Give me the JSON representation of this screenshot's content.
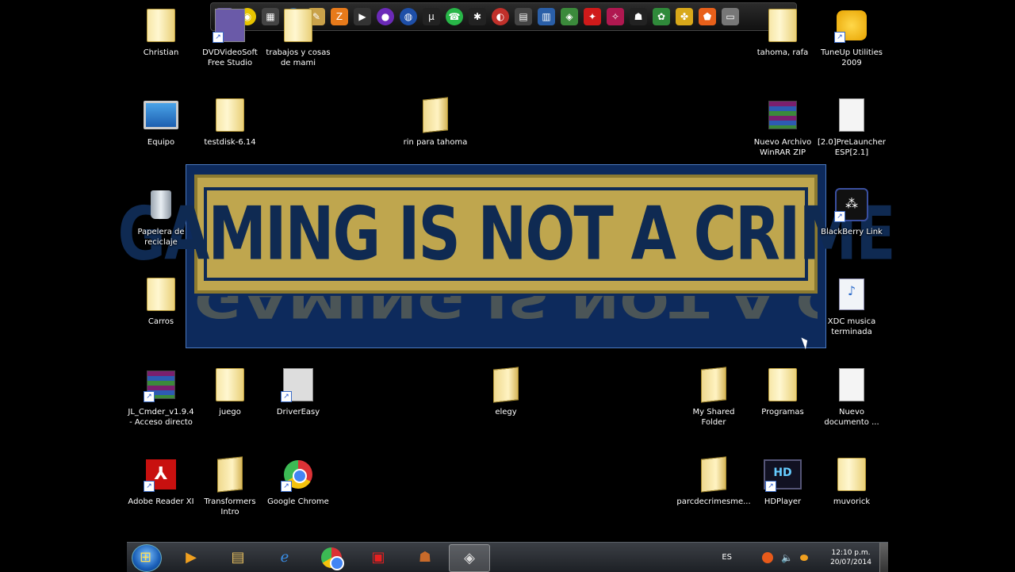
{
  "desktop_icons": [
    {
      "label": "Christian"
    },
    {
      "label": "DVDVideoSoft Free Studio"
    },
    {
      "label": "trabajos y cosas de mami"
    },
    {
      "label": "tahoma, rafa"
    },
    {
      "label": "TuneUp Utilities 2009"
    },
    {
      "label": "Equipo"
    },
    {
      "label": "testdisk-6.14"
    },
    {
      "label": "rin para tahoma"
    },
    {
      "label": "Nuevo Archivo WinRAR ZIP"
    },
    {
      "label": "[2.0]PreLauncher ESP[2.1]"
    },
    {
      "label": "Papelera de reciclaje"
    },
    {
      "label": "BlackBerry Link"
    },
    {
      "label": "Carros"
    },
    {
      "label": "XDC musica terminada"
    },
    {
      "label": "JL_Cmder_v1.9.4 - Acceso directo"
    },
    {
      "label": "juego"
    },
    {
      "label": "DriverEasy"
    },
    {
      "label": "elegy"
    },
    {
      "label": "My Shared Folder"
    },
    {
      "label": "Programas"
    },
    {
      "label": "Nuevo documento ..."
    },
    {
      "label": "Adobe Reader XI"
    },
    {
      "label": "Transformers Intro"
    },
    {
      "label": "Google Chrome"
    },
    {
      "label": "parcdecrimesme..."
    },
    {
      "label": "HDPlayer"
    },
    {
      "label": "muvorick"
    }
  ],
  "banner": {
    "text": "GAMING IS NOT A CRIME"
  },
  "dock_icons": [
    "folder-icon",
    "cd-icon",
    "mw-icon",
    "avast-icon",
    "tool-icon",
    "zone-icon",
    "media-icon",
    "orb-icon",
    "globe-icon",
    "utorrent-icon",
    "line-icon",
    "spider-icon",
    "game-icon",
    "gta-icon",
    "net-icon",
    "nvidia-icon",
    "red-icon",
    "dragon-icon",
    "spy-icon",
    "scan-icon",
    "gear-icon",
    "shield-icon",
    "drive-icon"
  ],
  "taskbar": {
    "apps": [
      "media-player-icon",
      "explorer-icon",
      "internet-explorer-icon",
      "chrome-icon",
      "kmplayer-icon",
      "game-character-icon",
      "game-app-icon"
    ],
    "lang": "ES",
    "time": "12:10 p.m.",
    "date": "20/07/2014"
  }
}
